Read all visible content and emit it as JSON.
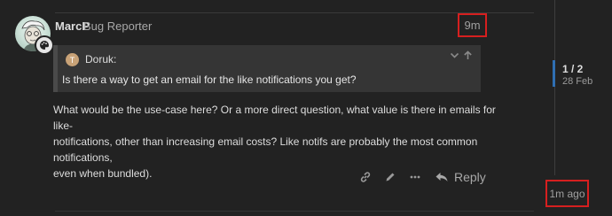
{
  "post": {
    "username": "MarcP",
    "user_title": "Bug Reporter",
    "relative_date": "9m",
    "quote": {
      "avatar_letter": "T",
      "username": "Doruk:",
      "text": "Is there a way to get an email for the like notifications you get?"
    },
    "body_lines": [
      "What would be the use-case here? Or a more direct question, what value is there in emails for like-",
      "notifications, other than increasing email costs? Like notifs are probably the most common notifications,",
      "even when bundled)."
    ],
    "actions": {
      "reply_label": "Reply"
    }
  },
  "timeline": {
    "count": "1 / 2",
    "date": "28 Feb",
    "last_activity": "1m ago"
  },
  "colors": {
    "background": "#222222",
    "highlight_border": "#d61f1f",
    "timeline_handle": "#2f6fb3"
  }
}
